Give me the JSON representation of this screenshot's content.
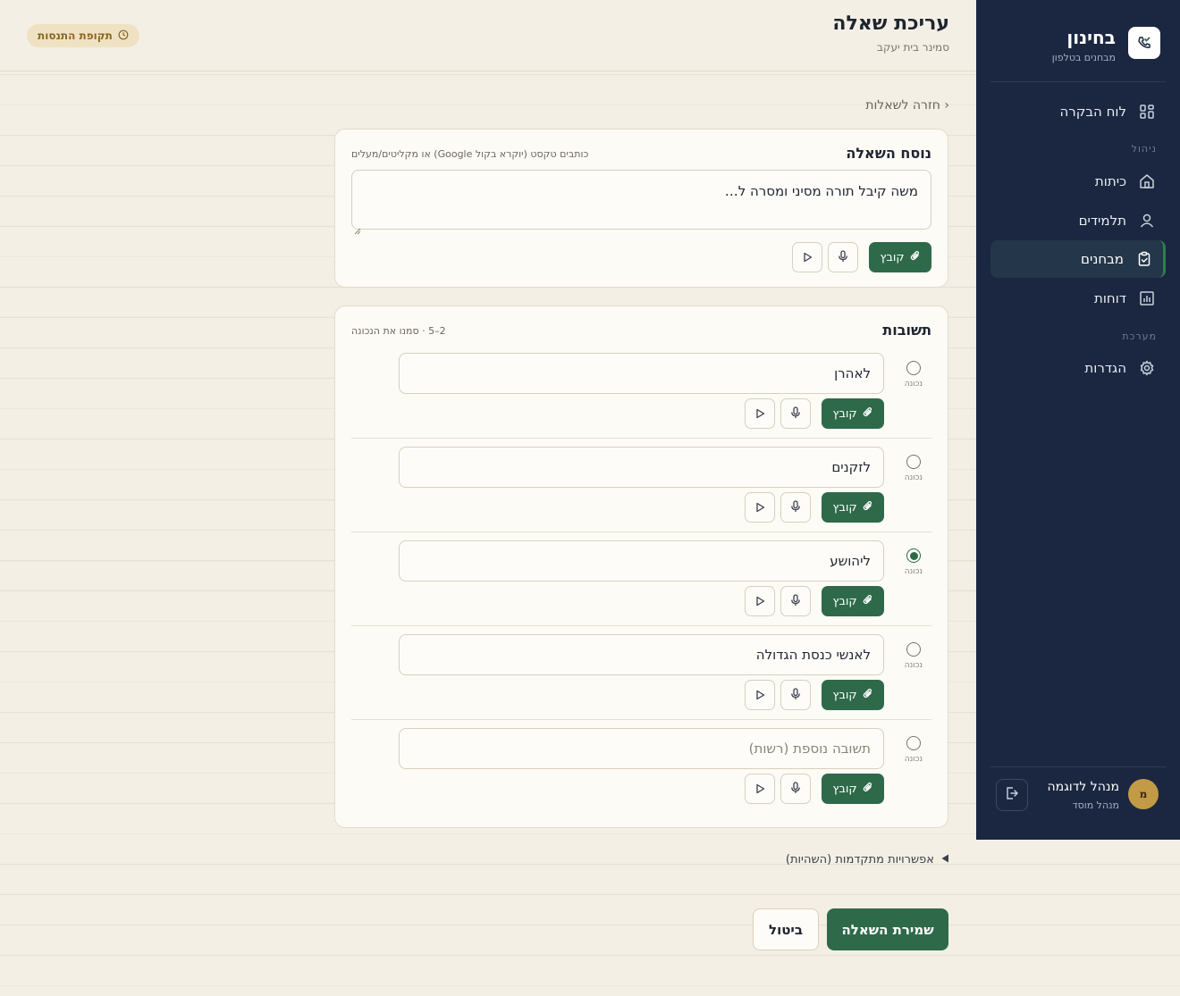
{
  "app": {
    "name": "בחינון",
    "tagline": "מבחנים בטלפון"
  },
  "sidebar": {
    "dashboard": "לוח הבקרה",
    "section_manage": "ניהול",
    "classes": "כיתות",
    "students": "תלמידים",
    "exams": "מבחנים",
    "reports": "דוחות",
    "section_system": "מערכת",
    "settings": "הגדרות",
    "active_item": "exams"
  },
  "user": {
    "initial": "מ",
    "name": "מנהל לדוגמה",
    "role": "מנהל מוסד"
  },
  "header": {
    "title": "עריכת שאלה",
    "subtitle": "סמינר בית יעקב",
    "trial_badge": "תקופת התנסות"
  },
  "back_link": "‹ חזרה לשאלות",
  "question": {
    "title": "נוסח השאלה",
    "hint": "כותבים טקסט (יוקרא בקול Google) או מקליטים/מעלים",
    "text": "משה קיבל תורה מסיני ומסרה ל…",
    "file_label": "קובץ"
  },
  "answers": {
    "title": "תשובות",
    "hint": "2–5 · סמנו את הנכונה",
    "correct_label": "נכונה",
    "file_label": "קובץ",
    "items": [
      {
        "text": "לאהרן",
        "placeholder": "",
        "correct": false
      },
      {
        "text": "לזקנים",
        "placeholder": "",
        "correct": false
      },
      {
        "text": "ליהושע",
        "placeholder": "",
        "correct": true
      },
      {
        "text": "לאנשי כנסת הגדולה",
        "placeholder": "",
        "correct": false
      },
      {
        "text": "",
        "placeholder": "תשובה נוספת (רשות)",
        "correct": false
      }
    ]
  },
  "advanced_options": "אפשרויות מתקדמות (השהיות)",
  "actions": {
    "save": "שמירת השאלה",
    "cancel": "ביטול"
  },
  "colors": {
    "sidebar_bg": "#1b2740",
    "accent_green": "#2e6a4a",
    "page_bg": "#f3efe4",
    "badge_bg": "#efe2c3",
    "avatar": "#c39a45"
  }
}
